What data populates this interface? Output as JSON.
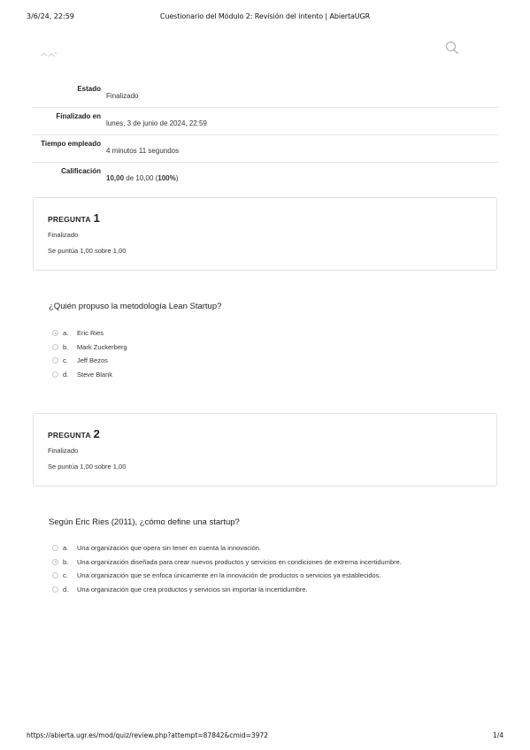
{
  "print_header": {
    "datetime": "3/6/24, 22:59",
    "title": "Cuestionario del Módulo 2: Revisión del intento | AbiertaUGR"
  },
  "summary": [
    {
      "label": "Estado",
      "value": "Finalizado"
    },
    {
      "label": "Finalizado en",
      "value": "lunes, 3 de junio de 2024, 22:59"
    },
    {
      "label": "Tiempo empleado",
      "value": "4 minutos 11 segundos"
    },
    {
      "label": "Calificación",
      "score": "10,00",
      "of_text": " de 10,00 (",
      "percent": "100%",
      "close": ")"
    }
  ],
  "questions": [
    {
      "word": "PREGUNTA",
      "number": "1",
      "state": "Finalizado",
      "grade": "Se puntúa 1,00 sobre 1,00",
      "text": "¿Quién propuso la metodología Lean Startup?",
      "selected": "a",
      "options": [
        {
          "letter": "a.",
          "text": "Eric Ries"
        },
        {
          "letter": "b.",
          "text": "Mark Zuckerberg"
        },
        {
          "letter": "c.",
          "text": "Jeff Bezos"
        },
        {
          "letter": "d.",
          "text": "Steve Blank"
        }
      ]
    },
    {
      "word": "PREGUNTA",
      "number": "2",
      "state": "Finalizado",
      "grade": "Se puntúa 1,00 sobre 1,00",
      "text": "Según Eric Ries (2011), ¿cómo define una startup?",
      "selected": "b",
      "options": [
        {
          "letter": "a.",
          "text": "Una organización que opera sin tener en cuenta la innovación."
        },
        {
          "letter": "b.",
          "text": "Una organización diseñada para crear nuevos productos y servicios en condiciones de extrema incertidumbre."
        },
        {
          "letter": "c.",
          "text": "Una organización que se enfoca únicamente en la innovación de productos o servicios ya establecidos."
        },
        {
          "letter": "d.",
          "text": "Una organización que crea productos y servicios sin importar la incertidumbre."
        }
      ]
    }
  ],
  "icons": {
    "search": "search-icon",
    "logo": "site-logo"
  },
  "print_footer": {
    "url": "https://abierta.ugr.es/mod/quiz/review.php?attempt=87842&cmid=3972",
    "page": "1/4"
  }
}
